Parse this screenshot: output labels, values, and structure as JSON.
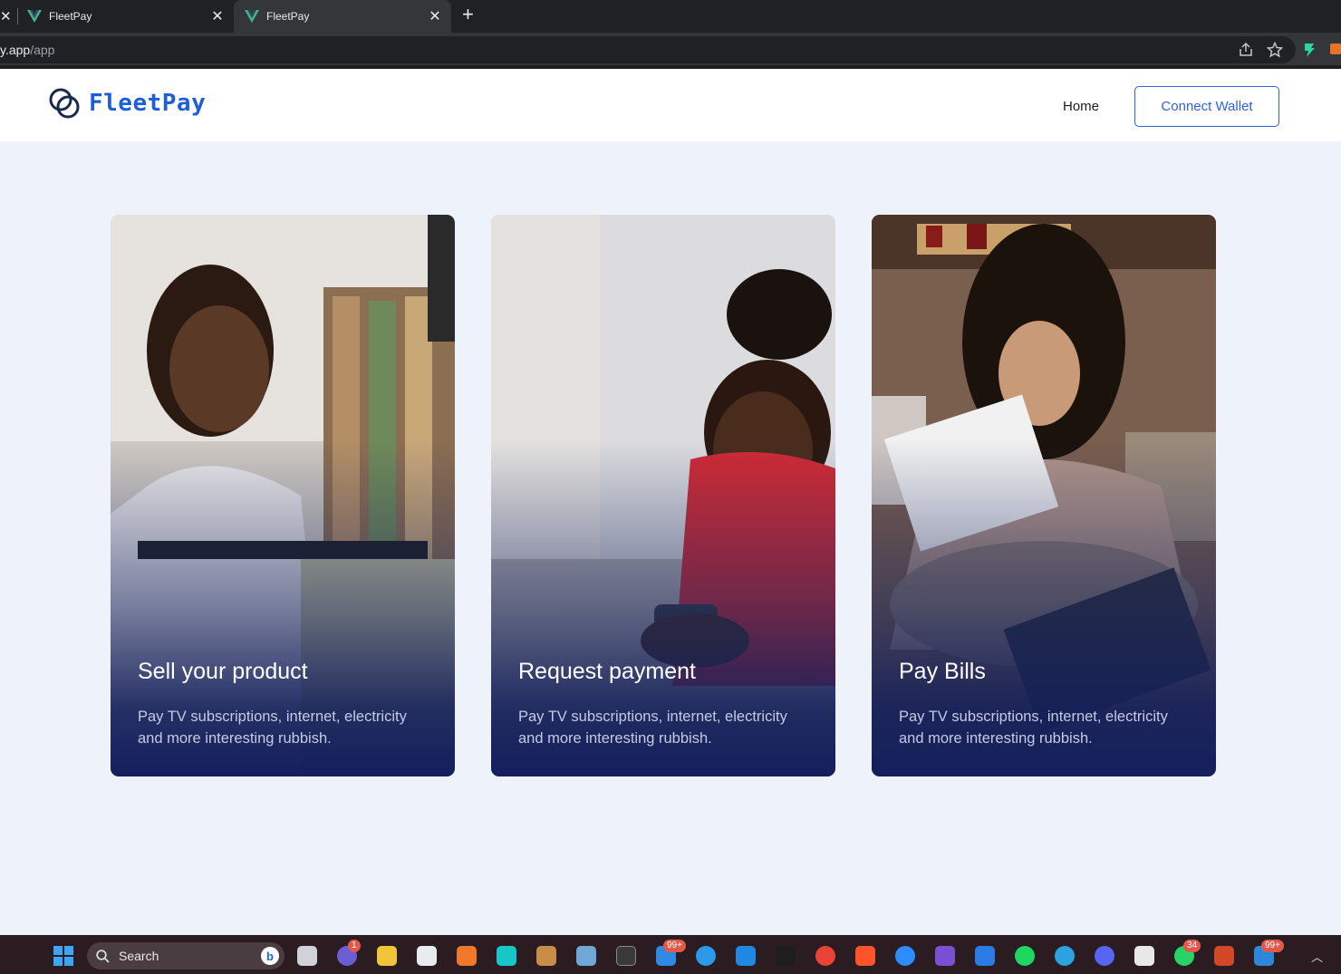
{
  "browser": {
    "tabs": [
      {
        "title": "FleetPay",
        "active": false
      },
      {
        "title": "FleetPay",
        "active": true
      }
    ],
    "url_main": "y.app",
    "url_path": "/app"
  },
  "header": {
    "brand": "FleetPay",
    "nav_home": "Home",
    "connect_wallet": "Connect Wallet"
  },
  "cards": [
    {
      "title": "Sell your product",
      "description": "Pay TV subscriptions, internet, electricity and more interesting rubbish."
    },
    {
      "title": "Request payment",
      "description": "Pay TV subscriptions, internet, electricity and more interesting rubbish."
    },
    {
      "title": "Pay Bills",
      "description": "Pay TV subscriptions, internet, electricity and more interesting rubbish."
    }
  ],
  "taskbar": {
    "search_label": "Search",
    "badges": {
      "teams": "1",
      "mail": "99+",
      "whatsapp": "34",
      "other": "99+"
    }
  },
  "colors": {
    "brand_blue": "#1e5eda",
    "page_bg": "#eef2fb",
    "card_gradient_end": "#141f5c"
  }
}
